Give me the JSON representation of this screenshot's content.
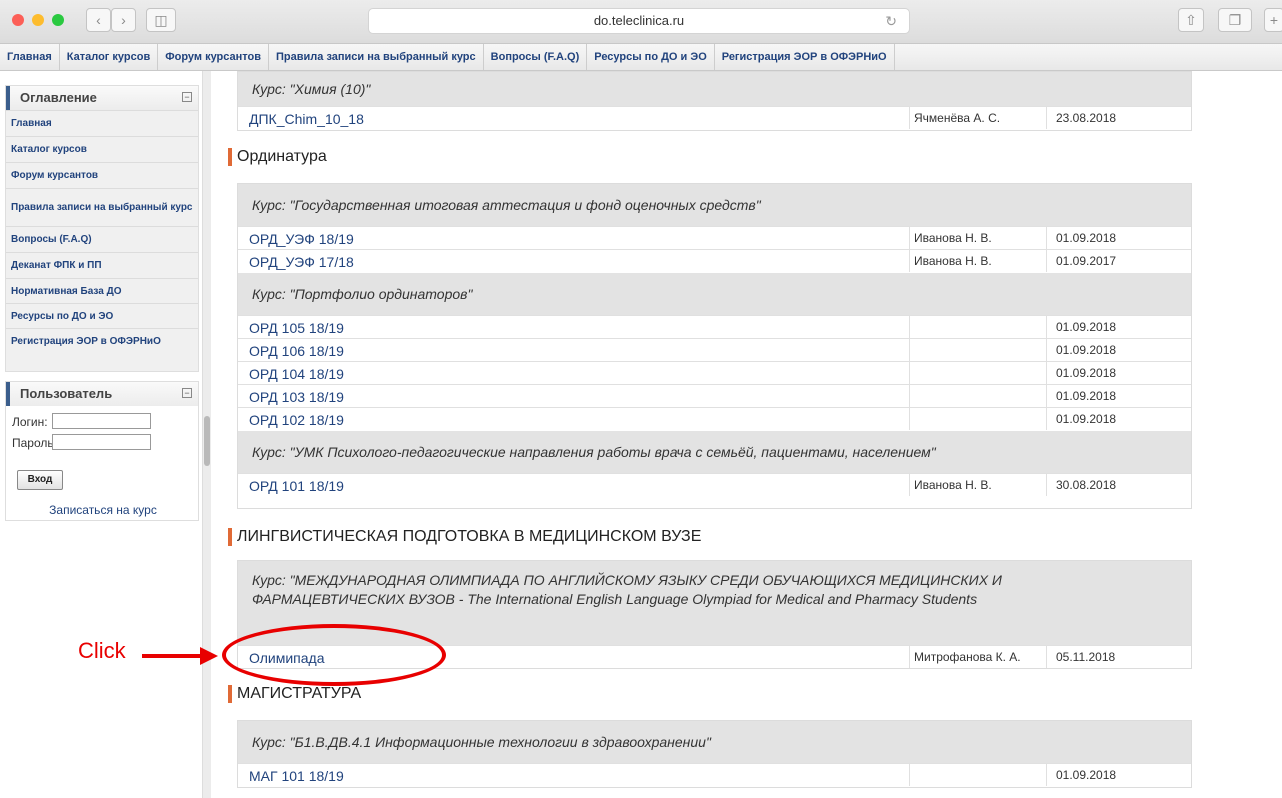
{
  "browser": {
    "url": "do.teleclinica.ru"
  },
  "topnav": [
    "Главная",
    "Каталог курсов",
    "Форум курсантов",
    "Правила записи на выбранный курс",
    "Вопросы (F.A.Q)",
    "Ресурсы по ДО и ЭО",
    "Регистрация ЭОР в ОФЭРНиО"
  ],
  "toc": {
    "title": "Оглавление",
    "items": [
      "Главная",
      "Каталог курсов",
      "Форум курсантов",
      "Правила записи на выбранный курс",
      "Вопросы (F.A.Q)",
      "Деканат ФПК и ПП",
      "Нормативная База ДО",
      "Ресурсы по ДО и ЭО",
      "Регистрация ЭОР в ОФЭРНиО"
    ]
  },
  "user": {
    "title": "Пользователь",
    "login_label": "Логин:",
    "password_label": "Пароль:",
    "login_button": "Вход",
    "enroll_link": "Записаться на курс"
  },
  "sections": {
    "chem": {
      "course": "Курс: \"Химия (10)\"",
      "row": {
        "name": "ДПК_Chim_10_18",
        "teacher": "Ячменёва А. С.",
        "date": "23.08.2018"
      }
    },
    "ord": {
      "title": "Ординатура",
      "c1": {
        "course": "Курс: \"Государственная итоговая аттестация и фонд оценочных средств\"",
        "rows": [
          {
            "name": "ОРД_УЭФ 18/19",
            "teacher": "Иванова Н. В.",
            "date": "01.09.2018"
          },
          {
            "name": "ОРД_УЭФ 17/18",
            "teacher": "Иванова Н. В.",
            "date": "01.09.2017"
          }
        ]
      },
      "c2": {
        "course": "Курс: \"Портфолио ординаторов\"",
        "rows": [
          {
            "name": "ОРД 105 18/19",
            "teacher": "",
            "date": "01.09.2018"
          },
          {
            "name": "ОРД 106 18/19",
            "teacher": "",
            "date": "01.09.2018"
          },
          {
            "name": "ОРД 104 18/19",
            "teacher": "",
            "date": "01.09.2018"
          },
          {
            "name": "ОРД 103 18/19",
            "teacher": "",
            "date": "01.09.2018"
          },
          {
            "name": "ОРД 102 18/19",
            "teacher": "",
            "date": "01.09.2018"
          }
        ]
      },
      "c3": {
        "course": "Курс: \"УМК Психолого-педагогические направления работы врача с семьёй, пациентами, населением\"",
        "rows": [
          {
            "name": "ОРД 101 18/19",
            "teacher": "Иванова Н. В.",
            "date": "30.08.2018"
          }
        ]
      }
    },
    "ling": {
      "title": "ЛИНГВИСТИЧЕСКАЯ ПОДГОТОВКА В МЕДИЦИНСКОМ ВУЗЕ",
      "course_line1": "Курс: \"МЕЖДУНАРОДНАЯ ОЛИМПИАДА ПО АНГЛИЙСКОМУ ЯЗЫКУ СРЕДИ ОБУЧАЮЩИХСЯ МЕДИЦИНСКИХ И",
      "course_line2": "ФАРМАЦЕВТИЧЕСКИХ ВУЗОВ - The International English Language Olympiad for Medical and Pharmacy Students",
      "row": {
        "name": "Олимипада",
        "teacher": "Митрофанова К. А.",
        "date": "05.11.2018"
      }
    },
    "mag": {
      "title": "МАГИСТРАТУРА",
      "course": "Курс: \"Б1.В.ДВ.4.1 Информационные технологии в здравоохранении\"",
      "row": {
        "name": "МАГ 101 18/19",
        "teacher": "",
        "date": "01.09.2018"
      }
    }
  },
  "annotation": {
    "label": "Click",
    "color": "#e80000"
  },
  "colors": {
    "link": "#21437d",
    "section_accent": "#e06a36",
    "course_bg": "#e3e3e3"
  }
}
